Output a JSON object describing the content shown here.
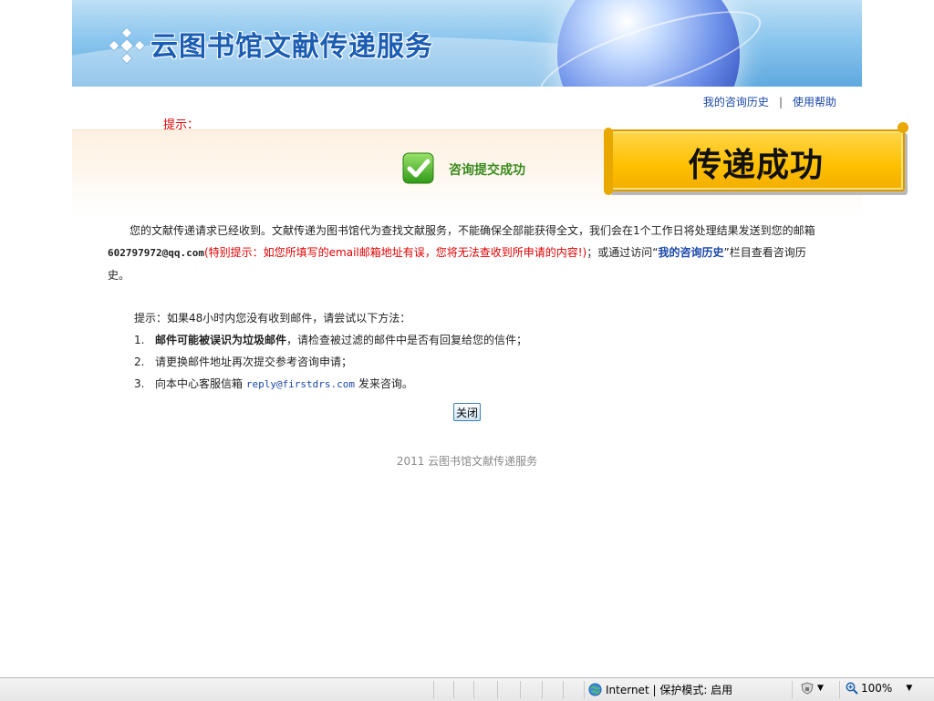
{
  "banner": {
    "title": "云图书馆文献传递服务"
  },
  "toplinks": {
    "history": "我的咨询历史",
    "separator": "|",
    "help": "使用帮助"
  },
  "hint_label": "提示：",
  "success": {
    "text": "咨询提交成功",
    "ribbon": "传递成功"
  },
  "message": {
    "part1": "您的文献传递请求已经收到。文献传递为图书馆代为查找文献服务，不能确保全部能获得全文，我们会在1个工作日将处理结果发送到您的邮箱",
    "email": "602797972@qq.com",
    "warning": "(特别提示：如您所填写的email邮箱地址有误，您将无法查收到所申请的内容!)",
    "part2": "；或通过访问“",
    "history_link": "我的咨询历史",
    "part3": "”栏目查看咨询历史。"
  },
  "tips": {
    "intro": "提示：如果48小时内您没有收到邮件，请尝试以下方法：",
    "items": [
      {
        "num": "1.",
        "bold": "邮件可能被误识为垃圾邮件",
        "text": "，请检查被过滤的邮件中是否有回复给您的信件；"
      },
      {
        "num": "2.",
        "text": "请更换邮件地址再次提交参考咨询申请；"
      },
      {
        "num": "3.",
        "pre": "向本中心客服信箱 ",
        "email": "reply@firstdrs.com",
        "post": " 发来咨询。"
      }
    ]
  },
  "close_label": "关闭",
  "footer": "2011 云图书馆文献传递服务",
  "statusbar": {
    "zone": "Internet | 保护模式: 启用",
    "zoom": "100%",
    "dropdown": "▼"
  },
  "icons": {
    "logo": "diamond-cluster-icon",
    "success": "green-check-icon",
    "zone": "globe-icon",
    "security": "shield-lock-icon",
    "zoom": "magnifier-icon"
  },
  "colors": {
    "link": "#1a47a8",
    "warning": "#e00000",
    "success": "#3a8a1e",
    "ribbon": "#ffc000"
  }
}
